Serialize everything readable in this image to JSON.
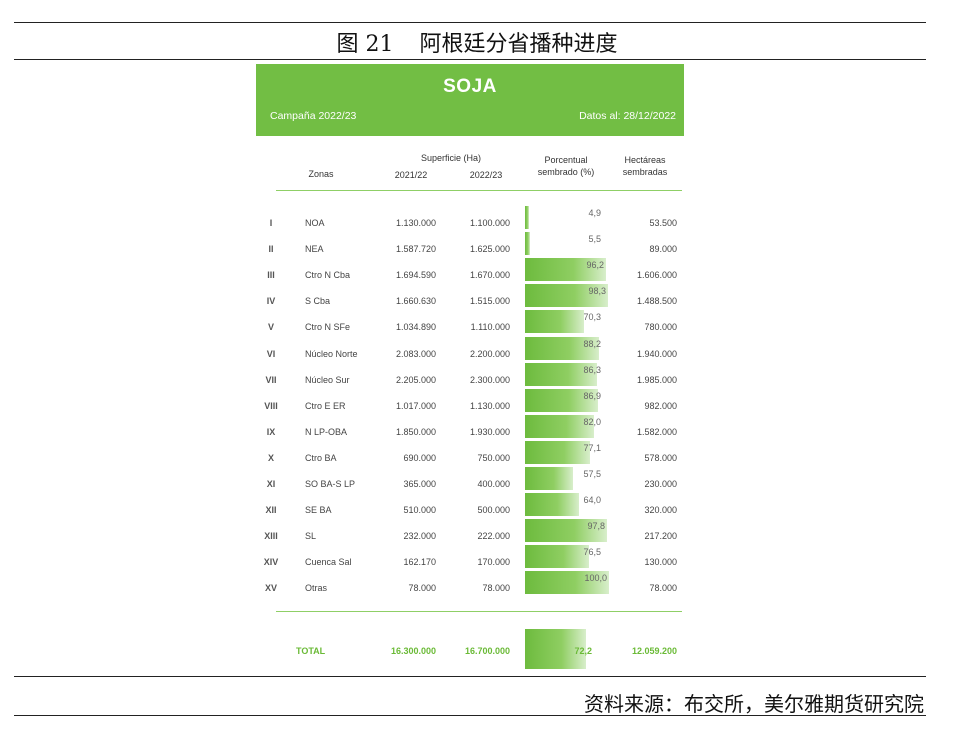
{
  "figure": {
    "number": "图 21",
    "title": "阿根廷分省播种进度"
  },
  "panel": {
    "title": "SOJA",
    "campaign": "Campaña 2022/23",
    "date": "Datos al: 28/12/2022"
  },
  "headers": {
    "zonas": "Zonas",
    "superficie": "Superficie (Ha)",
    "y1": "2021/22",
    "y2": "2022/23",
    "porcentual_1": "Porcentual",
    "porcentual_2": "sembrado (%)",
    "hectareas_1": "Hectáreas",
    "hectareas_2": "sembradas"
  },
  "rows": [
    {
      "roman": "I",
      "zone": "NOA",
      "v2021": "1.130.000",
      "v2022": "1.100.000",
      "pct_label": "4,9",
      "pct": 4.9,
      "ha": "53.500"
    },
    {
      "roman": "II",
      "zone": "NEA",
      "v2021": "1.587.720",
      "v2022": "1.625.000",
      "pct_label": "5,5",
      "pct": 5.5,
      "ha": "89.000"
    },
    {
      "roman": "III",
      "zone": "Ctro N Cba",
      "v2021": "1.694.590",
      "v2022": "1.670.000",
      "pct_label": "96,2",
      "pct": 96.2,
      "ha": "1.606.000"
    },
    {
      "roman": "IV",
      "zone": "S Cba",
      "v2021": "1.660.630",
      "v2022": "1.515.000",
      "pct_label": "98,3",
      "pct": 98.3,
      "ha": "1.488.500"
    },
    {
      "roman": "V",
      "zone": "Ctro N SFe",
      "v2021": "1.034.890",
      "v2022": "1.110.000",
      "pct_label": "70,3",
      "pct": 70.3,
      "ha": "780.000"
    },
    {
      "roman": "VI",
      "zone": "Núcleo Norte",
      "v2021": "2.083.000",
      "v2022": "2.200.000",
      "pct_label": "88,2",
      "pct": 88.2,
      "ha": "1.940.000"
    },
    {
      "roman": "VII",
      "zone": "Núcleo Sur",
      "v2021": "2.205.000",
      "v2022": "2.300.000",
      "pct_label": "86,3",
      "pct": 86.3,
      "ha": "1.985.000"
    },
    {
      "roman": "VIII",
      "zone": "Ctro E ER",
      "v2021": "1.017.000",
      "v2022": "1.130.000",
      "pct_label": "86,9",
      "pct": 86.9,
      "ha": "982.000"
    },
    {
      "roman": "IX",
      "zone": "N LP-OBA",
      "v2021": "1.850.000",
      "v2022": "1.930.000",
      "pct_label": "82,0",
      "pct": 82.0,
      "ha": "1.582.000"
    },
    {
      "roman": "X",
      "zone": "Ctro BA",
      "v2021": "690.000",
      "v2022": "750.000",
      "pct_label": "77,1",
      "pct": 77.1,
      "ha": "578.000"
    },
    {
      "roman": "XI",
      "zone": "SO BA-S LP",
      "v2021": "365.000",
      "v2022": "400.000",
      "pct_label": "57,5",
      "pct": 57.5,
      "ha": "230.000"
    },
    {
      "roman": "XII",
      "zone": "SE BA",
      "v2021": "510.000",
      "v2022": "500.000",
      "pct_label": "64,0",
      "pct": 64.0,
      "ha": "320.000"
    },
    {
      "roman": "XIII",
      "zone": "SL",
      "v2021": "232.000",
      "v2022": "222.000",
      "pct_label": "97,8",
      "pct": 97.8,
      "ha": "217.200"
    },
    {
      "roman": "XIV",
      "zone": "Cuenca Sal",
      "v2021": "162.170",
      "v2022": "170.000",
      "pct_label": "76,5",
      "pct": 76.5,
      "ha": "130.000"
    },
    {
      "roman": "XV",
      "zone": "Otras",
      "v2021": "78.000",
      "v2022": "78.000",
      "pct_label": "100,0",
      "pct": 100.0,
      "ha": "78.000"
    }
  ],
  "total": {
    "label": "TOTAL",
    "v2021": "16.300.000",
    "v2022": "16.700.000",
    "pct_label": "72,2",
    "pct": 72.2,
    "ha": "12.059.200"
  },
  "source": {
    "text": "资料来源：布交所，美尔雅期货研究院"
  },
  "colors": {
    "green": "#72be44",
    "total_text": "#6aba36"
  }
}
